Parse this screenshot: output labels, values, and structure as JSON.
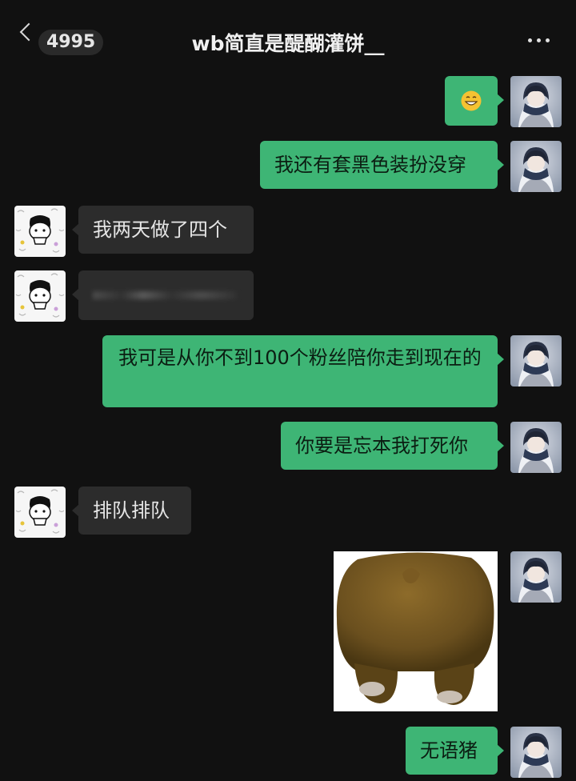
{
  "header": {
    "unread_count": "4995",
    "title": "wb简直是醍醐灌饼__"
  },
  "messages": [
    {
      "side": "me",
      "type": "emoji",
      "emoji": "grinning-face"
    },
    {
      "side": "me",
      "type": "text",
      "text": "我还有套黑色装扮没穿"
    },
    {
      "side": "other",
      "type": "text",
      "text": "我两天做了四个"
    },
    {
      "side": "other",
      "type": "text",
      "text": ""
    },
    {
      "side": "me",
      "type": "text",
      "text": "我可是从你不到100个粉丝陪你走到现在的"
    },
    {
      "side": "me",
      "type": "text",
      "text": "你要是忘本我打死你"
    },
    {
      "side": "other",
      "type": "text",
      "text": "排队排队"
    },
    {
      "side": "me",
      "type": "sticker",
      "sticker": "bear-back-sticker"
    },
    {
      "side": "me",
      "type": "text",
      "text": "无语猪"
    }
  ],
  "colors": {
    "background": "#111111",
    "my_bubble": "#3eb575",
    "other_bubble": "#2c2c2c"
  }
}
